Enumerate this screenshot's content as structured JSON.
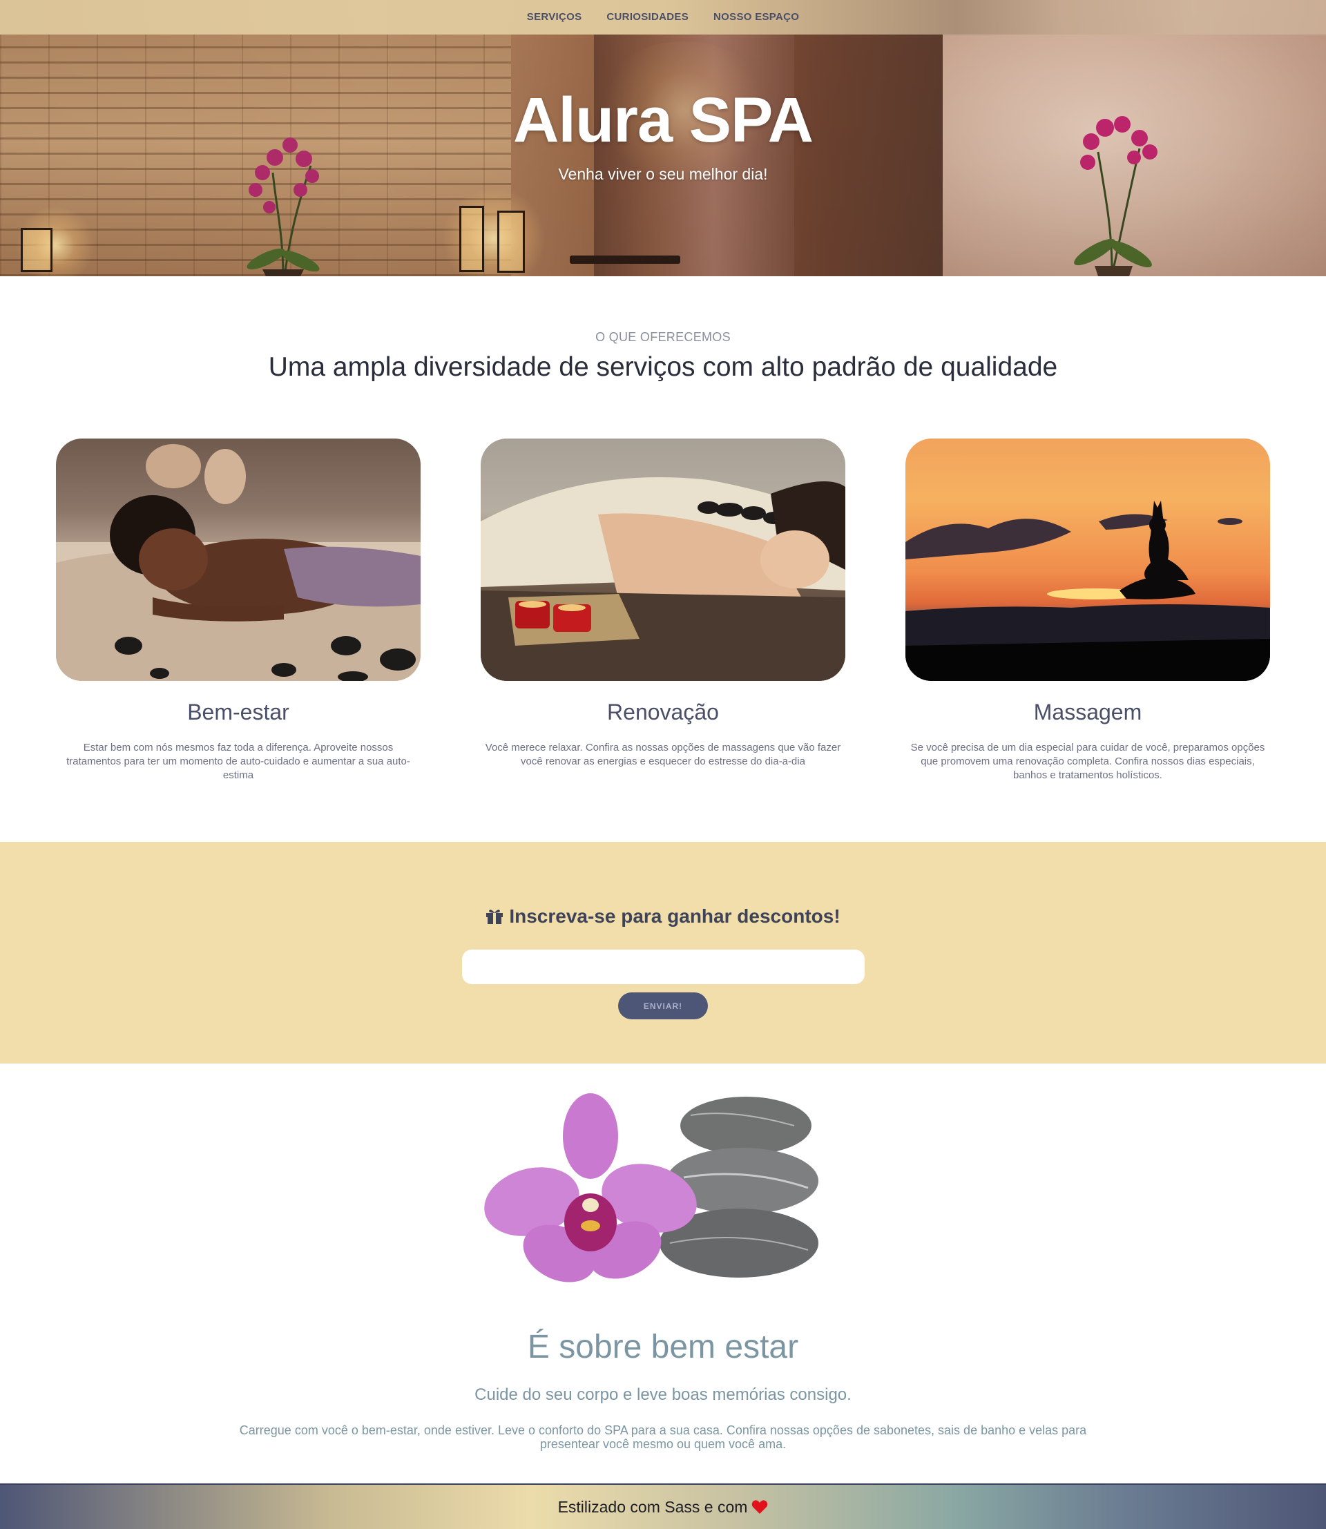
{
  "nav": {
    "items": [
      {
        "label": "SERVIÇOS"
      },
      {
        "label": "CURIOSIDADES"
      },
      {
        "label": "NOSSO ESPAÇO"
      }
    ]
  },
  "hero": {
    "title": "Alura SPA",
    "subtitle": "Venha viver o seu melhor dia!"
  },
  "services": {
    "eyebrow": "O QUE OFERECEMOS",
    "heading": "Uma ampla diversidade de serviços com alto padrão de qualidade",
    "cards": [
      {
        "title": "Bem-estar",
        "text": "Estar bem com nós mesmos faz toda a diferença. Aproveite nossos tratamentos para ter um momento de auto-cuidado e aumentar a sua auto-estima"
      },
      {
        "title": "Renovação",
        "text": "Você merece relaxar. Confira as nossas opções de massagens que vão fazer você renovar as energias e esquecer do estresse do dia-a-dia"
      },
      {
        "title": "Massagem",
        "text": "Se você precisa de um dia especial para cuidar de você, preparamos opções que promovem uma renovação completa. Confira nossos dias especiais, banhos e tratamentos holísticos."
      }
    ]
  },
  "newsletter": {
    "title": "Inscreva-se para ganhar descontos!",
    "icon": "gift-icon",
    "input_value": "",
    "input_placeholder": "",
    "button_label": "ENVIAR!"
  },
  "about": {
    "title": "É sobre bem estar",
    "subtitle": "Cuide do seu corpo e leve boas memórias consigo.",
    "text": "Carregue com você o bem-estar, onde estiver. Leve o conforto do SPA para a sua casa. Confira nossas opções de sabonetes, sais de banho e velas para presentear você mesmo ou quem você ama."
  },
  "footer": {
    "text": "Estilizado com Sass e com",
    "icon": "heart-icon"
  },
  "colors": {
    "nav_bg": "#e0cb9e",
    "newsletter_bg": "#f1deab",
    "button_bg": "#4e5677",
    "about_text": "#7b96a2",
    "heart": "#e0121b"
  }
}
